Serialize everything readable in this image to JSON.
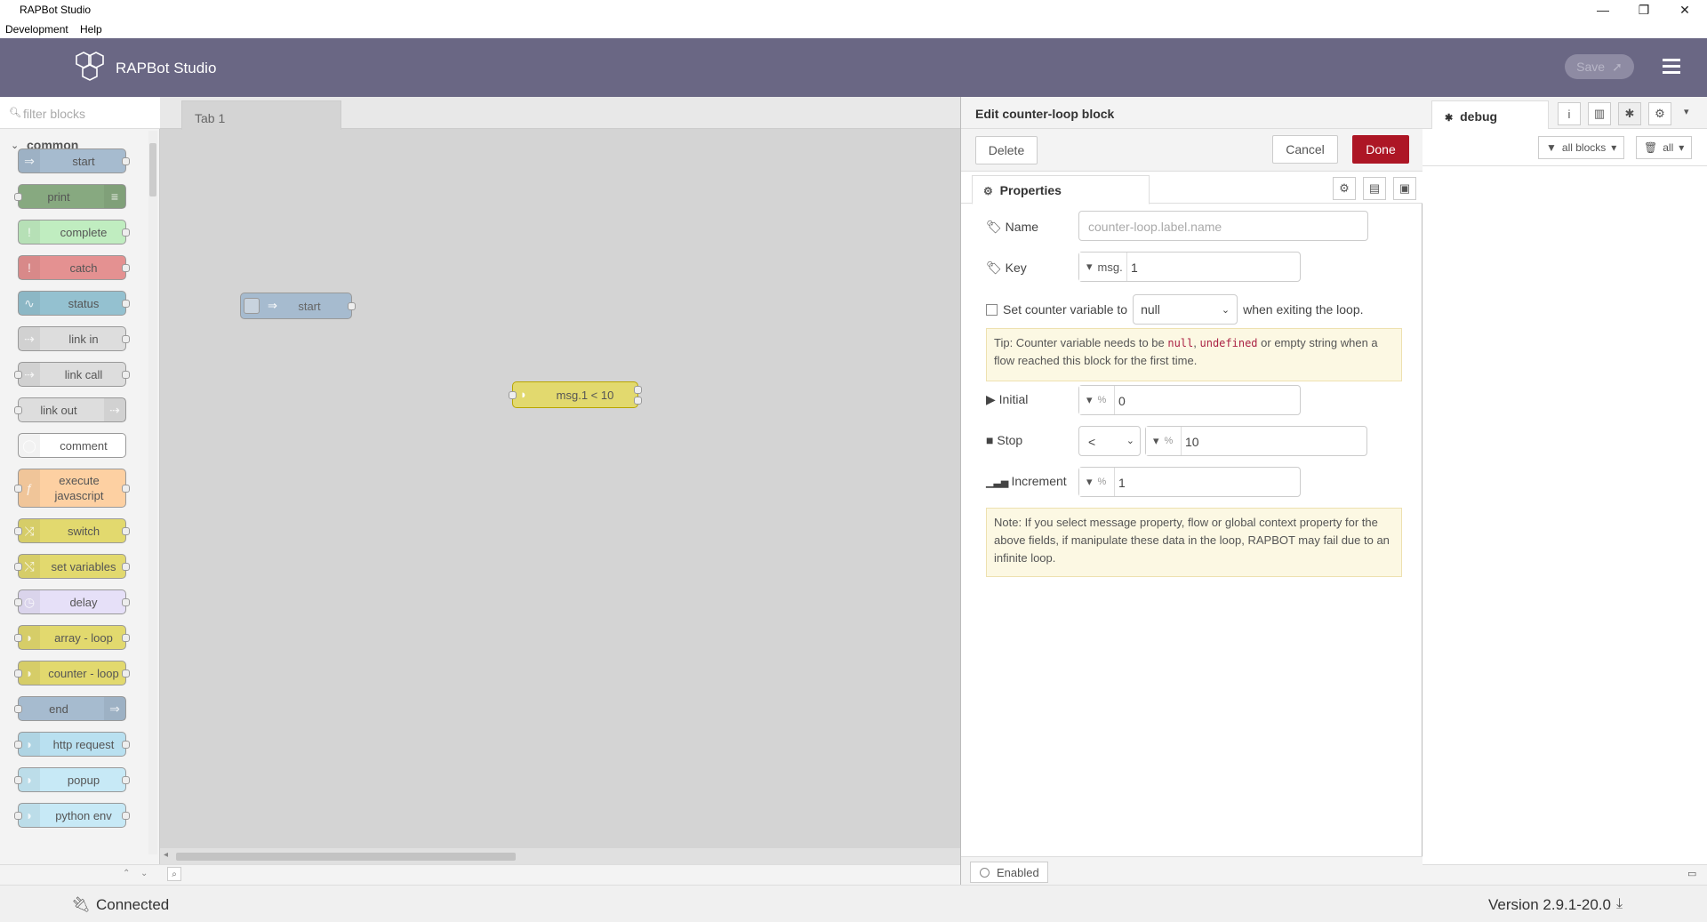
{
  "window": {
    "title": "RAPBot Studio",
    "controls": {
      "minimize": "—",
      "restore": "❐",
      "close": "✕"
    }
  },
  "menubar": {
    "items": [
      "Development",
      "Help"
    ]
  },
  "header": {
    "brand": "RAPBot Studio",
    "save_label": "Save",
    "colors": {
      "bar": "#6a6784",
      "save": "#8e8ba3"
    }
  },
  "palette": {
    "search_placeholder": "filter blocks",
    "category": "common",
    "nodes": [
      {
        "label": "start",
        "color": "#a6bbcf",
        "icon": "arrow-in-icon"
      },
      {
        "label": "print",
        "color": "#87a980",
        "icon": "list-icon"
      },
      {
        "label": "complete",
        "color": "#c0edc0",
        "icon": "exclamation-icon"
      },
      {
        "label": "catch",
        "color": "#e49191",
        "icon": "exclamation-icon"
      },
      {
        "label": "status",
        "color": "#94c1d0",
        "icon": "pulse-icon"
      },
      {
        "label": "link in",
        "color": "#dddddd",
        "icon": "link-icon"
      },
      {
        "label": "link call",
        "color": "#dddddd",
        "icon": "link-icon"
      },
      {
        "label": "link out",
        "color": "#dddddd",
        "icon": "link-icon"
      },
      {
        "label": "comment",
        "color": "#ffffff",
        "icon": "comment-icon"
      },
      {
        "label": "execute javascript",
        "color": "#fdd0a2",
        "icon": "function-icon"
      },
      {
        "label": "switch",
        "color": "#e2d96e",
        "icon": "switch-icon"
      },
      {
        "label": "set variables",
        "color": "#e2d96e",
        "icon": "shuffle-icon"
      },
      {
        "label": "delay",
        "color": "#e6e0f8",
        "icon": "clock-icon"
      },
      {
        "label": "array - loop",
        "color": "#e2d96e",
        "icon": "loop-icon"
      },
      {
        "label": "counter - loop",
        "color": "#e2d96e",
        "icon": "loop-icon"
      },
      {
        "label": "end",
        "color": "#a6bbcf",
        "icon": "arrow-out-icon"
      },
      {
        "label": "http request",
        "color": "#b9e0f0",
        "icon": "globe-icon"
      },
      {
        "label": "popup",
        "color": "#c7e9f6",
        "icon": "popup-icon"
      },
      {
        "label": "python env",
        "color": "#c7e9f6",
        "icon": "python-icon"
      }
    ]
  },
  "workspace": {
    "tab": "Tab 1",
    "nodes": [
      {
        "label": "start",
        "color": "#a6bbcf"
      },
      {
        "label": "msg.1 < 10",
        "color": "#e2d96e"
      }
    ]
  },
  "tray": {
    "title": "Edit counter-loop block",
    "delete_label": "Delete",
    "cancel_label": "Cancel",
    "done_label": "Done",
    "properties_tab": "Properties",
    "fields": {
      "name_label": "Name",
      "name_placeholder": "counter-loop.label.name",
      "key_label": "Key",
      "key_prefix": "msg.",
      "key_value": "1",
      "set_counter_label": "Set counter variable to",
      "set_counter_value": "null",
      "set_counter_suffix": "when exiting the loop.",
      "initial_label": "Initial",
      "initial_type": "%",
      "initial_value": "0",
      "stop_label": "Stop",
      "stop_operator": "<",
      "stop_type": "%",
      "stop_value": "10",
      "increment_label": "Increment",
      "increment_type": "%",
      "increment_value": "1"
    },
    "tip": {
      "p1": "Tip: Counter variable needs to be ",
      "c1": "null",
      "p2": ", ",
      "c2": "undefined",
      "p3": " or empty string when a flow reached this block for the first time."
    },
    "note": "Note: If you select message property, flow or global context property for the above fields, if manipulate these data in the loop, RAPBOT may fail due to an infinite loop.",
    "enabled_label": "Enabled",
    "colors": {
      "done": "#ad1625"
    }
  },
  "sidebar": {
    "tab": "debug",
    "filter_label": "all blocks",
    "clear_label": "all"
  },
  "status": {
    "connection": "Connected",
    "version": "Version 2.9.1-20.0"
  }
}
